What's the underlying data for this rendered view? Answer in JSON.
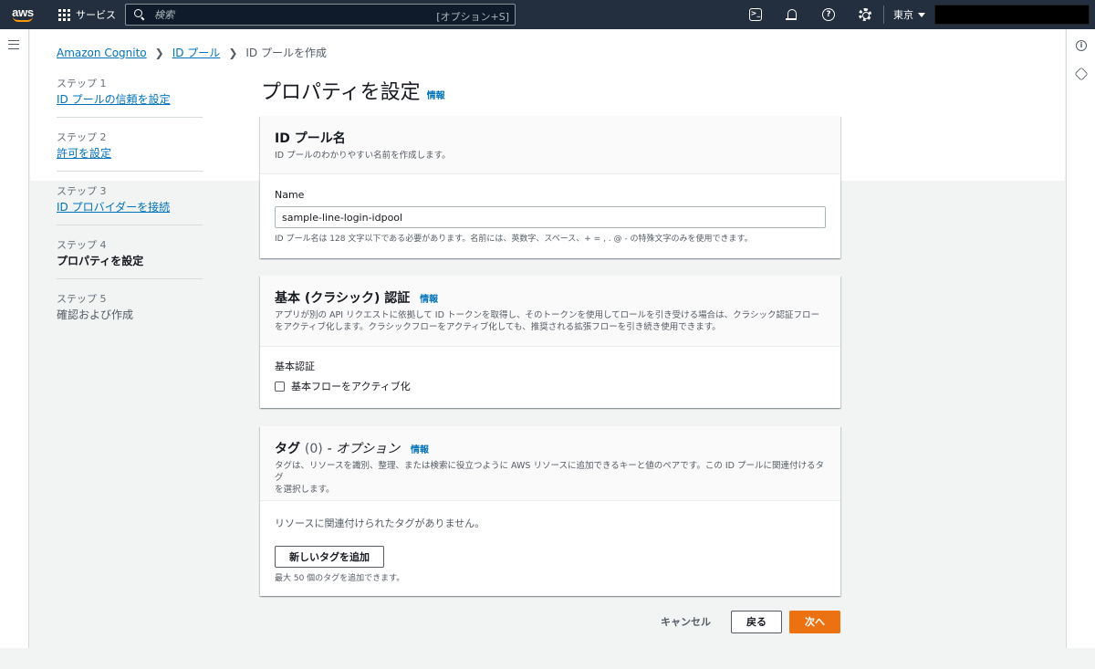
{
  "topnav": {
    "logo_text": "aws",
    "services_label": "サービス",
    "search_placeholder": "検索",
    "search_shortcut": "[オプション+S]",
    "region": "東京",
    "icons": [
      "cloudshell-icon",
      "bell-icon",
      "help-icon",
      "gear-icon"
    ]
  },
  "breadcrumb": {
    "items": [
      "Amazon Cognito",
      "ID プール",
      "ID プールを作成"
    ]
  },
  "steps": [
    {
      "num": "ステップ 1",
      "label": "ID プールの信頼を設定"
    },
    {
      "num": "ステップ 2",
      "label": "許可を設定"
    },
    {
      "num": "ステップ 3",
      "label": "ID プロバイダーを接続"
    },
    {
      "num": "ステップ 4",
      "label": "プロパティを設定"
    },
    {
      "num": "ステップ 5",
      "label": "確認および作成"
    }
  ],
  "page": {
    "title": "プロパティを設定",
    "info": "情報"
  },
  "pool_name_panel": {
    "title": "ID プール名",
    "description": "ID プールのわかりやすい名前を作成します。",
    "field_label": "Name",
    "value": "sample-line-login-idpool",
    "hint": "ID プール名は 128 文字以下である必要があります。名前には、英数字、スペース、+ = , . @ - の特殊文字のみを使用できます。"
  },
  "basic_auth_panel": {
    "title": "基本 (クラシック) 認証",
    "info": "情報",
    "description_line1": "アプリが別の API リクエストに依拠して ID トークンを取得し、そのトークンを使用してロールを引き受ける場合は、クラシック認証フロー",
    "description_line2": "をアクティブ化します。クラシックフローをアクティブ化しても、推奨される拡張フローを引き続き使用できます。",
    "field_label": "基本認証",
    "checkbox_label": "基本フローをアクティブ化"
  },
  "tags_panel": {
    "title": "タグ",
    "count": "(0)",
    "optional": "- オプション",
    "info": "情報",
    "description_line1": "タグは、リソースを識別、整理、または検索に役立つように AWS リソースに追加できるキーと値のペアです。この ID プールに関連付けるタグ",
    "description_line2": "を選択します。",
    "empty": "リソースに関連付けられたタグがありません。",
    "add_button": "新しいタグを追加",
    "limit_hint": "最大 50 個のタグを追加できます。"
  },
  "actions": {
    "cancel": "キャンセル",
    "back": "戻る",
    "next": "次へ"
  },
  "colors": {
    "nav_bg": "#232f3e",
    "link": "#0073bb",
    "primary": "#ec7211",
    "page_bg": "#f2f3f3"
  }
}
